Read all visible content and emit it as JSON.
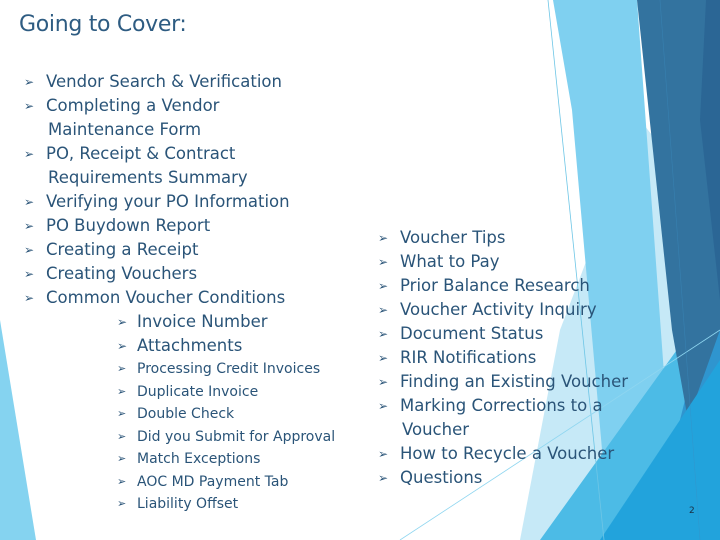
{
  "slide": {
    "title": "Going to Cover:",
    "page_number": "2",
    "bullet_glyph": "➢",
    "colors": {
      "text": "#2a5478",
      "title": "#2e5c82",
      "light_blue": "#7fd0f0",
      "mid_blue": "#3aaee0",
      "bright_blue": "#22a3dc",
      "steel_blue": "#33739f",
      "dark_blue": "#2b6695",
      "pale_blue": "#bfe6f6"
    }
  },
  "left_column": {
    "items": [
      {
        "label": "Vendor Search & Verification"
      },
      {
        "label": "Completing a Vendor",
        "continuation": "Maintenance Form"
      },
      {
        "label": "PO, Receipt & Contract",
        "continuation": "Requirements Summary"
      },
      {
        "label": "Verifying your PO Information"
      },
      {
        "label": "PO Buydown Report"
      },
      {
        "label": "Creating a Receipt"
      },
      {
        "label": "Creating Vouchers"
      },
      {
        "label": "Common Voucher Conditions"
      }
    ],
    "sub_items": [
      {
        "label": "Invoice Number"
      },
      {
        "label": "Attachments"
      }
    ],
    "small_sub_items": [
      {
        "label": "Processing Credit Invoices"
      },
      {
        "label": "Duplicate Invoice"
      },
      {
        "label": "Double Check"
      },
      {
        "label": "Did you Submit for Approval"
      },
      {
        "label": "Match Exceptions"
      },
      {
        "label": "AOC MD Payment Tab"
      },
      {
        "label": "Liability Offset"
      }
    ]
  },
  "right_column": {
    "items": [
      {
        "label": "Voucher Tips"
      },
      {
        "label": "What to Pay"
      },
      {
        "label": "Prior Balance Research"
      },
      {
        "label": "Voucher Activity Inquiry"
      },
      {
        "label": "Document Status"
      },
      {
        "label": "RIR Notifications"
      },
      {
        "label": "Finding an Existing Voucher"
      },
      {
        "label": "Marking Corrections to a",
        "continuation": "Voucher"
      },
      {
        "label": "How to Recycle a Voucher"
      },
      {
        "label": "Questions"
      }
    ]
  }
}
